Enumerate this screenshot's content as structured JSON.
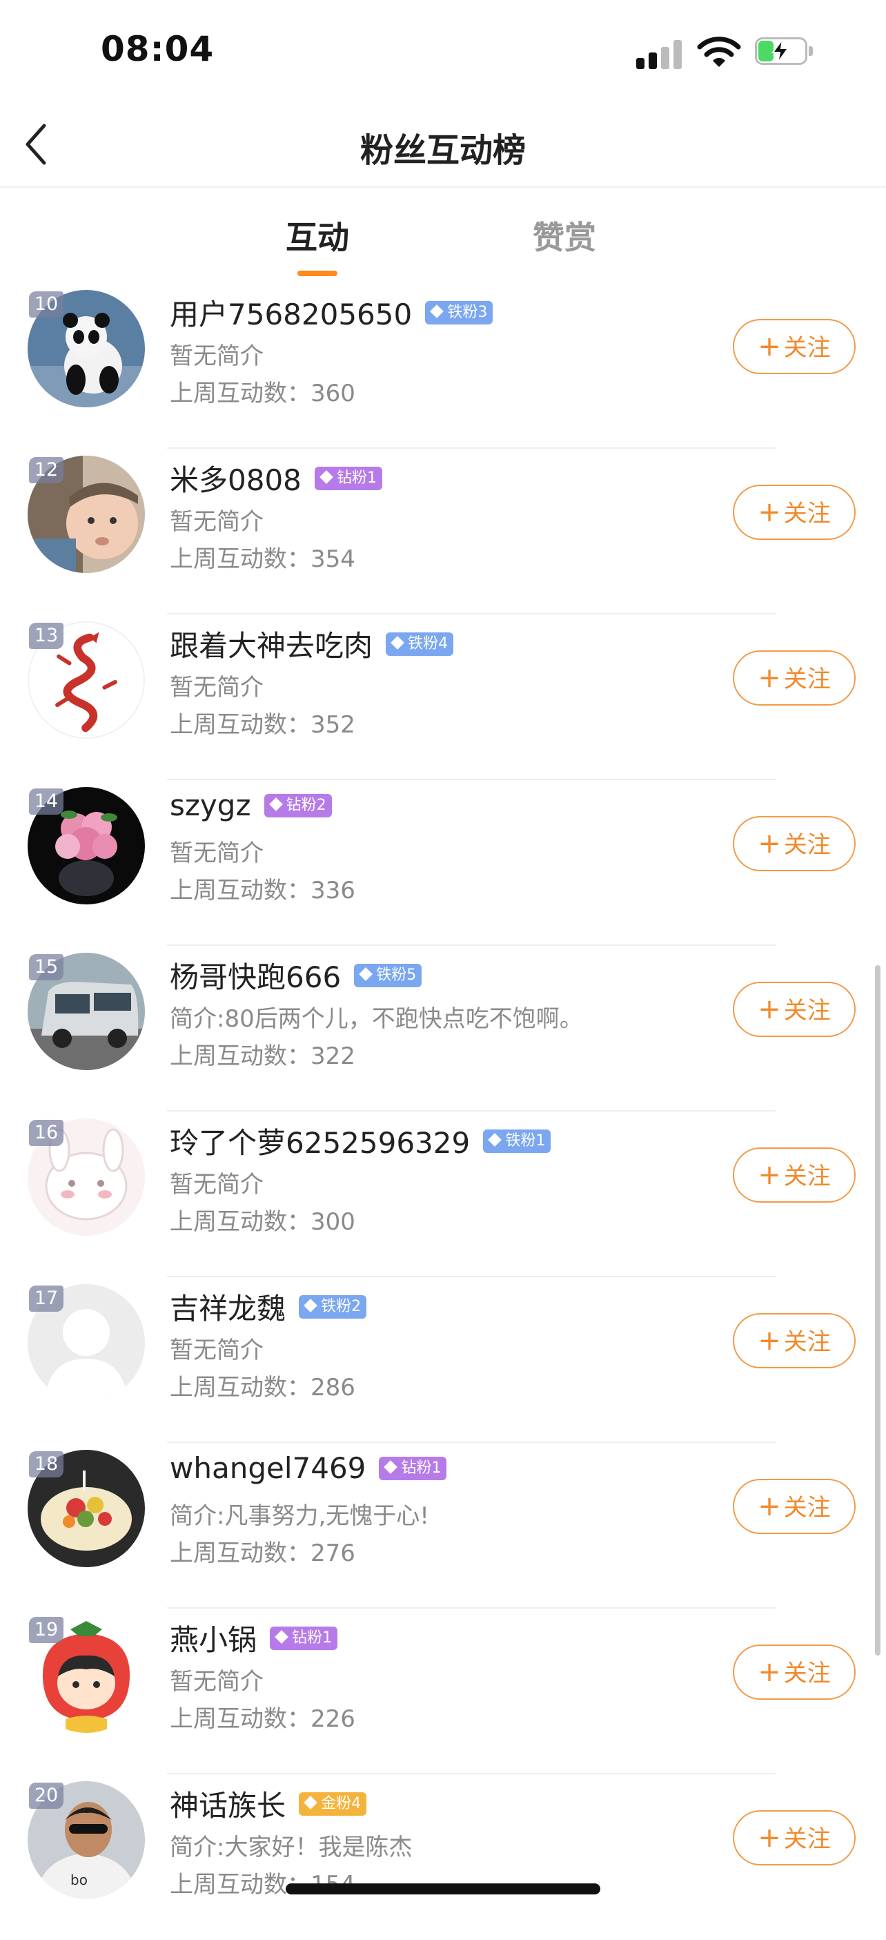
{
  "status_bar": {
    "time": "08:04"
  },
  "nav": {
    "title": "粉丝互动榜"
  },
  "tabs": [
    {
      "label": "互动",
      "active": true
    },
    {
      "label": "赞赏",
      "active": false
    }
  ],
  "follow_label": "关注",
  "fans": [
    {
      "rank": "10",
      "name": "用户7568205650",
      "badge": "铁粉3",
      "badge_type": "iron",
      "bio": "暂无简介",
      "count": "上周互动数：360",
      "avatar": "panda"
    },
    {
      "rank": "12",
      "name": "米多0808",
      "badge": "钻粉1",
      "badge_type": "diamond",
      "bio": "暂无简介",
      "count": "上周互动数：354",
      "avatar": "baby-photo"
    },
    {
      "rank": "13",
      "name": "跟着大神去吃肉",
      "badge": "铁粉4",
      "badge_type": "iron",
      "bio": "暂无简介",
      "count": "上周互动数：352",
      "avatar": "red-dragon"
    },
    {
      "rank": "14",
      "name": "szygz",
      "badge": "钻粉2",
      "badge_type": "diamond",
      "bio": "暂无简介",
      "count": "上周互动数：336",
      "avatar": "pink-roses"
    },
    {
      "rank": "15",
      "name": "杨哥快跑666",
      "badge": "铁粉5",
      "badge_type": "iron",
      "bio": "简介:80后两个儿，不跑快点吃不饱啊。",
      "count": "上周互动数：322",
      "avatar": "camper-van"
    },
    {
      "rank": "16",
      "name": "玲了个萝6252596329",
      "badge": "铁粉1",
      "badge_type": "iron",
      "bio": "暂无简介",
      "count": "上周互动数：300",
      "avatar": "cartoon-bunny"
    },
    {
      "rank": "17",
      "name": "吉祥龙魏",
      "badge": "铁粉2",
      "badge_type": "iron",
      "bio": "暂无简介",
      "count": "上周互动数：286",
      "avatar": "default-user"
    },
    {
      "rank": "18",
      "name": "whangel7469",
      "badge": "钻粉1",
      "badge_type": "diamond",
      "bio": "简介:凡事努力,无愧于心!",
      "count": "上周互动数：276",
      "avatar": "fruit-cake"
    },
    {
      "rank": "19",
      "name": "燕小锅",
      "badge": "钻粉1",
      "badge_type": "diamond",
      "bio": "暂无简介",
      "count": "上周互动数：226",
      "avatar": "strawberry-girl"
    },
    {
      "rank": "20",
      "name": "神话族长",
      "badge": "金粉4",
      "badge_type": "gold",
      "bio": "简介:大家好！我是陈杰",
      "count": "上周互动数：154",
      "avatar": "man-sunglasses"
    }
  ]
}
